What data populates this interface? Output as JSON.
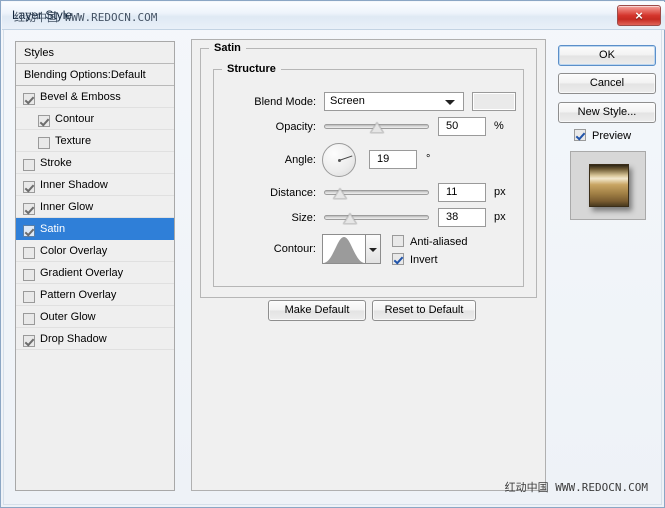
{
  "window": {
    "title": "Layer Style",
    "title_watermark": "红动中国 WWW.REDOCN.COM",
    "bottom_watermark": "红动中国 WWW.REDOCN.COM",
    "close_icon": "×"
  },
  "styles_panel": {
    "header": "Styles",
    "blending_options": "Blending Options:Default",
    "items": [
      {
        "label": "Bevel & Emboss",
        "checked": true,
        "indent": 0,
        "selected": false
      },
      {
        "label": "Contour",
        "checked": true,
        "indent": 1,
        "selected": false
      },
      {
        "label": "Texture",
        "checked": false,
        "indent": 1,
        "selected": false
      },
      {
        "label": "Stroke",
        "checked": false,
        "indent": 0,
        "selected": false
      },
      {
        "label": "Inner Shadow",
        "checked": true,
        "indent": 0,
        "selected": false
      },
      {
        "label": "Inner Glow",
        "checked": true,
        "indent": 0,
        "selected": false
      },
      {
        "label": "Satin",
        "checked": true,
        "indent": 0,
        "selected": true
      },
      {
        "label": "Color Overlay",
        "checked": false,
        "indent": 0,
        "selected": false
      },
      {
        "label": "Gradient Overlay",
        "checked": false,
        "indent": 0,
        "selected": false
      },
      {
        "label": "Pattern Overlay",
        "checked": false,
        "indent": 0,
        "selected": false
      },
      {
        "label": "Outer Glow",
        "checked": false,
        "indent": 0,
        "selected": false
      },
      {
        "label": "Drop Shadow",
        "checked": true,
        "indent": 0,
        "selected": false
      }
    ]
  },
  "satin": {
    "group_title": "Satin",
    "structure_title": "Structure",
    "blend_mode": {
      "label": "Blend Mode:",
      "value": "Screen",
      "swatch_color": "#eaeaea"
    },
    "opacity": {
      "label": "Opacity:",
      "value": "50",
      "unit": "%",
      "percent": 50
    },
    "angle": {
      "label": "Angle:",
      "value": "19",
      "unit": "°",
      "degrees": 19
    },
    "distance": {
      "label": "Distance:",
      "value": "11",
      "unit": "px",
      "percent": 10
    },
    "size": {
      "label": "Size:",
      "value": "38",
      "unit": "px",
      "percent": 21
    },
    "contour": {
      "label": "Contour:",
      "anti_aliased_label": "Anti-aliased",
      "anti_aliased_checked": false,
      "invert_label": "Invert",
      "invert_checked": true
    },
    "make_default_label": "Make Default",
    "reset_default_label": "Reset to Default"
  },
  "actions": {
    "ok_label": "OK",
    "cancel_label": "Cancel",
    "new_style_label": "New Style...",
    "preview_label": "Preview",
    "preview_checked": true
  }
}
